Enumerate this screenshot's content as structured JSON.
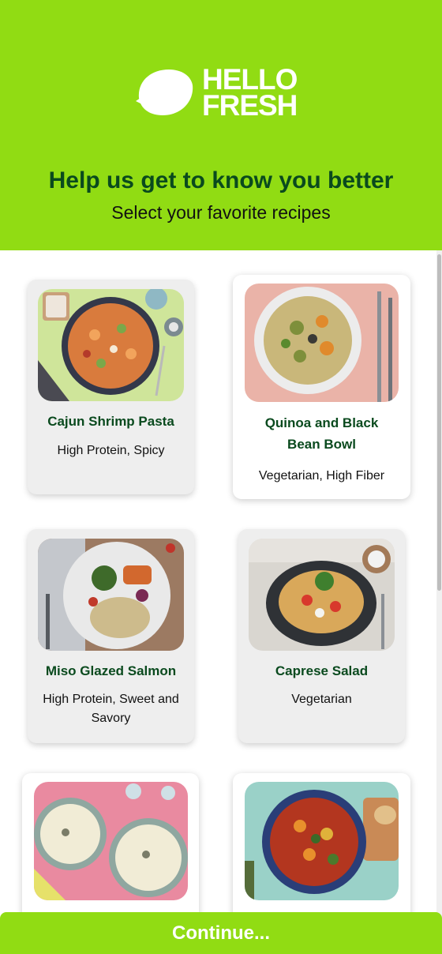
{
  "brand": {
    "line1": "HELLO",
    "line2": "FRESH",
    "color": "#91dc13",
    "text_color": "#0a4a1e"
  },
  "header": {
    "title": "Help us get to know you better",
    "subtitle": "Select your favorite recipes"
  },
  "recipes": [
    {
      "title": "Cajun Shrimp Pasta",
      "tags": "High Protein, Spicy",
      "selected": false,
      "image": "cajun-shrimp-pasta-photo"
    },
    {
      "title": "Quinoa and Black Bean Bowl",
      "tags": "Vegetarian, High Fiber",
      "selected": true,
      "image": "quinoa-bowl-photo"
    },
    {
      "title": "Miso Glazed Salmon",
      "tags": "High Protein, Sweet and Savory",
      "selected": false,
      "image": "miso-salmon-photo"
    },
    {
      "title": "Caprese Salad",
      "tags": "Vegetarian",
      "selected": false,
      "image": "caprese-salad-photo"
    },
    {
      "title": "",
      "tags": "",
      "selected": true,
      "image": "cream-soup-photo"
    },
    {
      "title": "",
      "tags": "",
      "selected": true,
      "image": "vegetable-stew-photo"
    }
  ],
  "footer": {
    "continue_label": "Continue..."
  }
}
